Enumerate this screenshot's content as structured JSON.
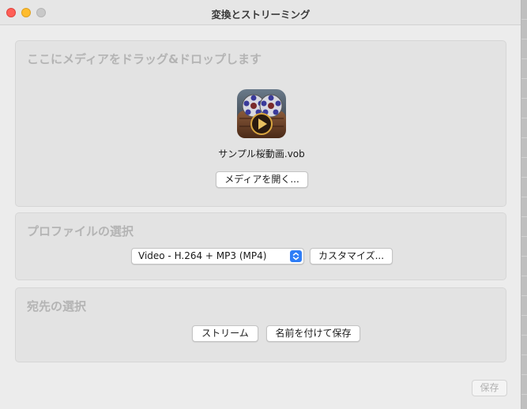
{
  "window": {
    "title": "変換とストリーミング"
  },
  "drop_panel": {
    "heading": "ここにメディアをドラッグ&ドロップします",
    "file_icon": "vlc-style-movie-reel-icon",
    "file_name": "サンプル桜動画.vob",
    "open_media_label": "メディアを開く..."
  },
  "profile_panel": {
    "heading": "プロファイルの選択",
    "selected_profile": "Video - H.264 + MP3 (MP4)",
    "customize_label": "カスタマイズ..."
  },
  "destination_panel": {
    "heading": "宛先の選択",
    "stream_label": "ストリーム",
    "save_as_label": "名前を付けて保存"
  },
  "footer": {
    "save_label": "保存"
  },
  "colors": {
    "accent": "#2f7df6",
    "close": "#ff5f57",
    "minimize": "#febc2e",
    "zoom_disabled": "#c8c8c8"
  }
}
